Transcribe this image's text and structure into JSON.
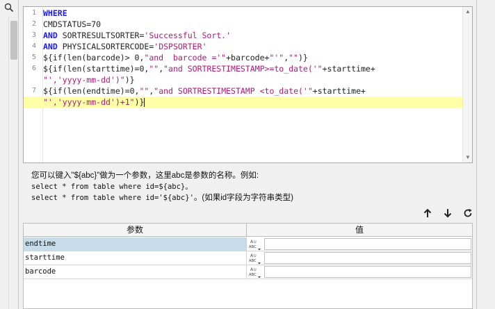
{
  "editor": {
    "lines": [
      {
        "n": "1",
        "parts": [
          {
            "t": "WHERE",
            "c": "kw"
          }
        ]
      },
      {
        "n": "2",
        "parts": [
          {
            "t": "CMDSTATUS=70",
            "c": "plain"
          }
        ]
      },
      {
        "n": "3",
        "parts": [
          {
            "t": "AND",
            "c": "kw"
          },
          {
            "t": " SORTRESULTSORTER=",
            "c": "plain"
          },
          {
            "t": "'Successful Sort.'",
            "c": "str"
          }
        ]
      },
      {
        "n": "4",
        "parts": [
          {
            "t": "AND",
            "c": "kw"
          },
          {
            "t": " PHYSICALSORTERCODE=",
            "c": "plain"
          },
          {
            "t": "'DSPSORTER'",
            "c": "str"
          }
        ]
      },
      {
        "n": "5",
        "parts": [
          {
            "t": "${if(len(barcode)> 0,",
            "c": "plain"
          },
          {
            "t": "\"and  barcode ='\"",
            "c": "str"
          },
          {
            "t": "+barcode+",
            "c": "plain"
          },
          {
            "t": "\"'\"",
            "c": "str"
          },
          {
            "t": ",",
            "c": "plain"
          },
          {
            "t": "\"\"",
            "c": "str"
          },
          {
            "t": ")}",
            "c": "plain"
          }
        ]
      },
      {
        "n": "6",
        "parts": [
          {
            "t": "${if(len(starttime)=0,",
            "c": "plain"
          },
          {
            "t": "\"\"",
            "c": "str"
          },
          {
            "t": ",",
            "c": "plain"
          },
          {
            "t": "\"and SORTRESTIMESTAMP>=to_date('\"",
            "c": "str"
          },
          {
            "t": "+starttime+",
            "c": "plain"
          }
        ]
      },
      {
        "n": "",
        "parts": [
          {
            "t": "\"','yyyy-mm-dd')\"",
            "c": "str"
          },
          {
            "t": ")}",
            "c": "plain"
          }
        ]
      },
      {
        "n": "7",
        "parts": [
          {
            "t": "${if(len(endtime)=0,",
            "c": "plain"
          },
          {
            "t": "\"\"",
            "c": "str"
          },
          {
            "t": ",",
            "c": "plain"
          },
          {
            "t": "\"and SORTRESTIMESTAMP <to_date('\"",
            "c": "str"
          },
          {
            "t": "+starttime+",
            "c": "plain"
          }
        ]
      },
      {
        "n": "",
        "hl": true,
        "parts": [
          {
            "t": "\"','yyyy-mm-dd')+1\"",
            "c": "str"
          },
          {
            "t": ")}",
            "c": "plain"
          }
        ]
      }
    ]
  },
  "hint": {
    "line1": "您可以键入\"${abc}\"做为一个参数，这里abc是参数的名称。例如:",
    "line2": "select * from table where id=${abc}。",
    "line3_code": "select * from table where id='${abc}'",
    "line3_tail": "。(如果id字段为字符串类型)"
  },
  "toolbar": {
    "up_icon": "arrow-up-icon",
    "down_icon": "arrow-down-icon",
    "refresh_icon": "refresh-icon"
  },
  "table": {
    "col_param": "参数",
    "col_value": "值",
    "type_badge_top": "A",
    "type_badge_mid": "ABC",
    "rows": [
      {
        "name": "endtime",
        "value": "",
        "selected": true
      },
      {
        "name": "starttime",
        "value": "",
        "selected": false
      },
      {
        "name": "barcode",
        "value": "",
        "selected": false
      }
    ]
  },
  "colors": {
    "keyword": "#1a1aff",
    "string": "#b0187a",
    "highlight_line": "#ffffa8",
    "selected_row": "#c6dceb"
  }
}
